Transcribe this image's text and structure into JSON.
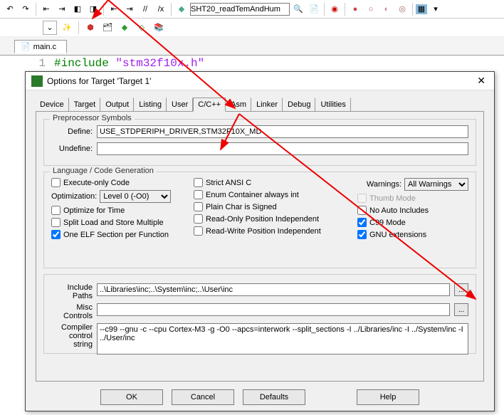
{
  "toolbar": {
    "project_combo": "SHT20_readTemAndHum"
  },
  "file_tab": "main.c",
  "code": {
    "line_no": "1",
    "include_kw": "#include",
    "include_str": "\"stm32f10x.h\""
  },
  "dialog": {
    "title": "Options for Target 'Target 1'",
    "tabs": [
      "Device",
      "Target",
      "Output",
      "Listing",
      "User",
      "C/C++",
      "Asm",
      "Linker",
      "Debug",
      "Utilities"
    ],
    "preproc": {
      "legend": "Preprocessor Symbols",
      "define_label": "Define:",
      "define_value": "USE_STDPERIPH_DRIVER,STM32F10X_MD",
      "undefine_label": "Undefine:",
      "undefine_value": ""
    },
    "lang": {
      "legend": "Language / Code Generation",
      "exec_only": "Execute-only Code",
      "optimization_label": "Optimization:",
      "optimization_value": "Level 0 (-O0)",
      "opt_time": "Optimize for Time",
      "split_ls": "Split Load and Store Multiple",
      "one_elf": "One ELF Section per Function",
      "strict_ansi": "Strict ANSI C",
      "enum_cont": "Enum Container always int",
      "plain_char": "Plain Char is Signed",
      "ro_pi": "Read-Only Position Independent",
      "rw_pi": "Read-Write Position Independent",
      "warnings_label": "Warnings:",
      "warnings_value": "All Warnings",
      "thumb": "Thumb Mode",
      "no_auto": "No Auto Includes",
      "c99": "C99 Mode",
      "gnu_ext": "GNU extensions"
    },
    "paths": {
      "include_label": "Include\nPaths",
      "include_value": "..\\Libraries\\inc;..\\System\\inc;..\\User\\inc",
      "misc_label": "Misc\nControls",
      "misc_value": "",
      "compiler_label": "Compiler\ncontrol\nstring",
      "compiler_value": "--c99 --gnu -c --cpu Cortex-M3 -g -O0 --apcs=interwork --split_sections -I ../Libraries/inc -I ../System/inc -I ../User/inc"
    },
    "buttons": {
      "ok": "OK",
      "cancel": "Cancel",
      "defaults": "Defaults",
      "help": "Help"
    }
  }
}
